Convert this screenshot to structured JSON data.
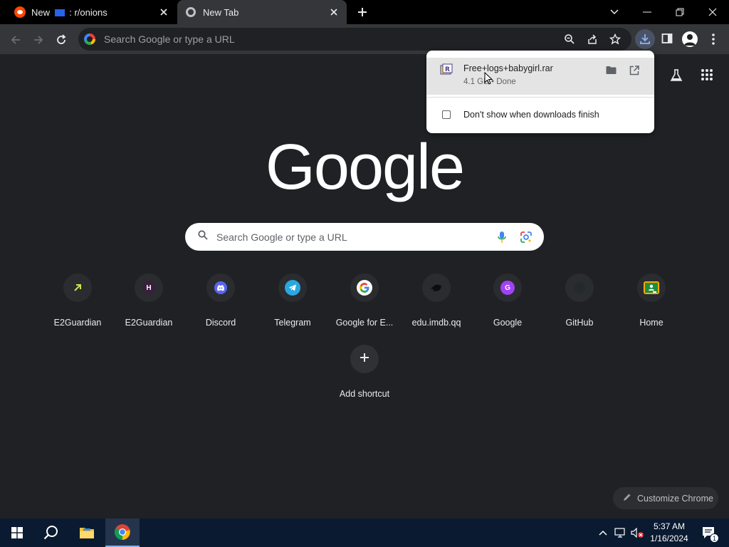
{
  "tabs": [
    {
      "prefix": "New ",
      "suffix": " : r/onions"
    },
    {
      "title": "New Tab"
    }
  ],
  "omnibox": {
    "placeholder": "Search Google or type a URL"
  },
  "download": {
    "filename": "Free+logs+babygirl.rar",
    "status": "4.1 GB • Done",
    "checkbox_label": "Don't show when downloads finish",
    "checked": false
  },
  "ntp": {
    "logo_text": "Google",
    "search_placeholder": "Search Google or type a URL",
    "shortcuts": [
      {
        "label": "E2Guardian",
        "icon": "e2guardian-arrow-icon",
        "color": "#c8e64b"
      },
      {
        "label": "E2Guardian",
        "icon": "h-letter-icon",
        "letter": "H",
        "color": "#3a1f3d"
      },
      {
        "label": "Discord",
        "icon": "discord-icon",
        "color": "#5865f2"
      },
      {
        "label": "Telegram",
        "icon": "telegram-icon",
        "color": "#2aa7e0"
      },
      {
        "label": "Google for E...",
        "icon": "google-g-icon",
        "color": "#ffffff"
      },
      {
        "label": "edu.imdb.qq",
        "icon": "bird-icon",
        "color": "#111111"
      },
      {
        "label": "Google",
        "icon": "g-letter-icon",
        "letter": "G",
        "color": "#a142f4"
      },
      {
        "label": "GitHub",
        "icon": "github-icon",
        "color": "#24292e"
      },
      {
        "label": "Home",
        "icon": "google-classroom-icon",
        "color": "#f9ab00"
      }
    ],
    "add_shortcut_label": "Add shortcut",
    "customize_label": "Customize Chrome"
  },
  "taskbar": {
    "time": "5:37 AM",
    "date": "1/16/2024",
    "notification_count": "1"
  },
  "colors": {
    "page_bg": "#202124",
    "toolbar_bg": "#35363a",
    "tabstrip_bg": "#000000",
    "taskbar_bg": "#0a1a30",
    "accent_blue": "#8ab4f8"
  }
}
